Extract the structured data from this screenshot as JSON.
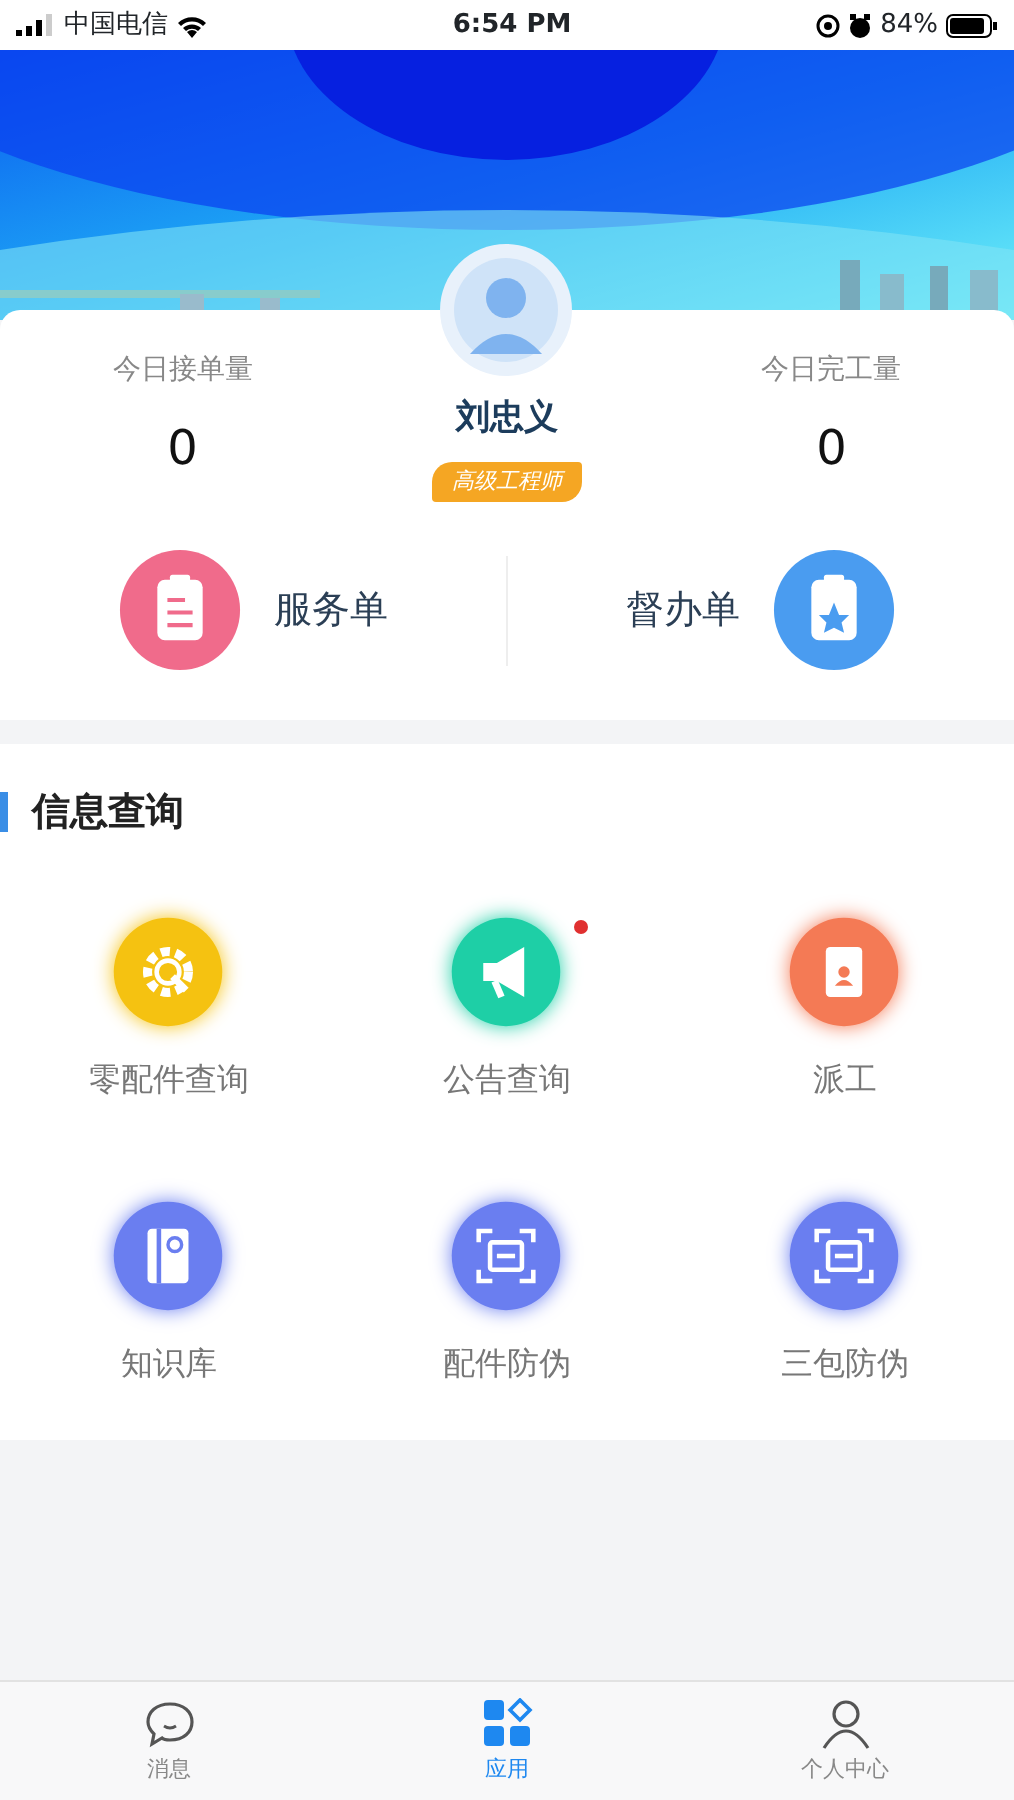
{
  "status_bar": {
    "carrier": "中国电信",
    "time": "6:54 PM",
    "battery": "84%"
  },
  "profile": {
    "name": "刘忠义",
    "title": "高级工程师"
  },
  "stats": [
    {
      "label": "今日接单量",
      "value": "0"
    },
    {
      "label": "今日完工量",
      "value": "0"
    }
  ],
  "orders": [
    {
      "label": "服务单",
      "kind": "service",
      "color": "#f06b8b"
    },
    {
      "label": "督办单",
      "kind": "supervise",
      "color": "#4a9cf0"
    }
  ],
  "section": {
    "title": "信息查询"
  },
  "tiles": [
    {
      "label": "零配件查询",
      "kind": "gear",
      "color": "#f5c211",
      "dot": false
    },
    {
      "label": "公告查询",
      "kind": "megaphone",
      "color": "#1ecfa6",
      "dot": true
    },
    {
      "label": "派工",
      "kind": "badge",
      "color": "#f47a55",
      "dot": false
    },
    {
      "label": "知识库",
      "kind": "book",
      "color": "#6a7ef0",
      "dot": false
    },
    {
      "label": "配件防伪",
      "kind": "scan",
      "color": "#6a7ef0",
      "dot": false
    },
    {
      "label": "三包防伪",
      "kind": "scan",
      "color": "#6a7ef0",
      "dot": false
    }
  ],
  "tabs": [
    {
      "label": "消息",
      "kind": "chat",
      "selected": false
    },
    {
      "label": "应用",
      "kind": "apps",
      "selected": true
    },
    {
      "label": "个人中心",
      "kind": "person",
      "selected": false
    }
  ]
}
